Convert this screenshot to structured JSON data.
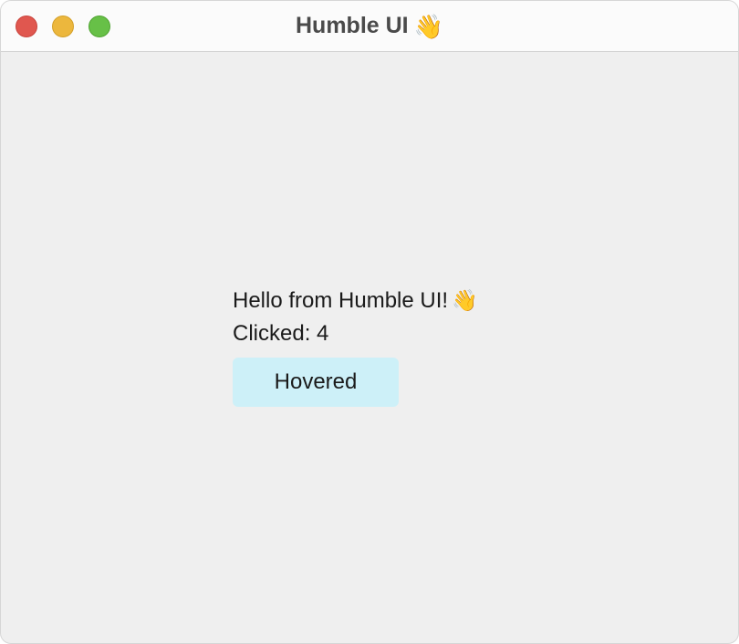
{
  "window": {
    "title": "Humble UI",
    "title_icon": "👋"
  },
  "traffic_lights": {
    "close_color": "#e0574f",
    "minimize_color": "#ecb73d",
    "zoom_color": "#67c047"
  },
  "main": {
    "greeting": "Hello from Humble UI!",
    "greeting_icon": "👋",
    "clicked_label": "Clicked: 4",
    "button_label": "Hovered",
    "button_color": "#cdf0f8"
  }
}
